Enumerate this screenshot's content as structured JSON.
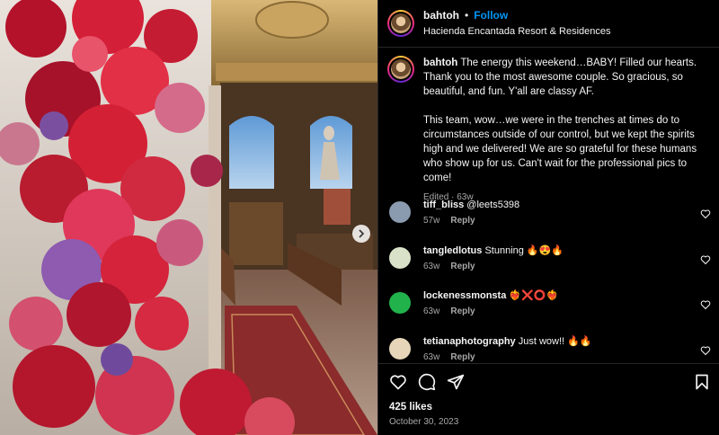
{
  "post": {
    "username": "bahtoh",
    "separator": "•",
    "follow_label": "Follow",
    "location": "Hacienda Encantada Resort & Residences"
  },
  "caption": {
    "username": "bahtoh",
    "paragraph1": "The energy this weekend…BABY! Filled our hearts. Thank you to the most awesome couple. So gracious, so beautiful, and fun. Y'all are classy AF.",
    "paragraph2": "This team, wow…we were in the trenches at times do to circumstances outside of our control, but we kept the spirits high and we delivered! We are so grateful for these humans who show up for us. Can't wait for the professional pics to come!",
    "edited": "Edited · 63w"
  },
  "comments": [
    {
      "user": "tiff_bliss",
      "text": "@leets5398",
      "time": "57w",
      "reply": "Reply",
      "avatar_color": "#8a9bb0"
    },
    {
      "user": "tangledlotus",
      "text": "Stunning 🔥😍🔥",
      "time": "63w",
      "reply": "Reply",
      "avatar_color": "#d9e2c8"
    },
    {
      "user": "lockenessmonsta",
      "text": "❤️‍🔥❌⭕❤️‍🔥",
      "time": "63w",
      "reply": "Reply",
      "avatar_color": "#22b24c"
    },
    {
      "user": "tetianaphotography",
      "text": "Just wow!! 🔥🔥",
      "time": "63w",
      "reply": "Reply",
      "avatar_color": "#e6d5b8"
    }
  ],
  "actions": {
    "like_icon": "heart-outline-icon",
    "comment_icon": "speech-bubble-icon",
    "share_icon": "paper-plane-icon",
    "save_icon": "bookmark-icon"
  },
  "likes": "425 likes",
  "date": "October 30, 2023",
  "colors": {
    "accent": "#0095f6",
    "muted": "#a8a8a8",
    "background": "#000000"
  }
}
